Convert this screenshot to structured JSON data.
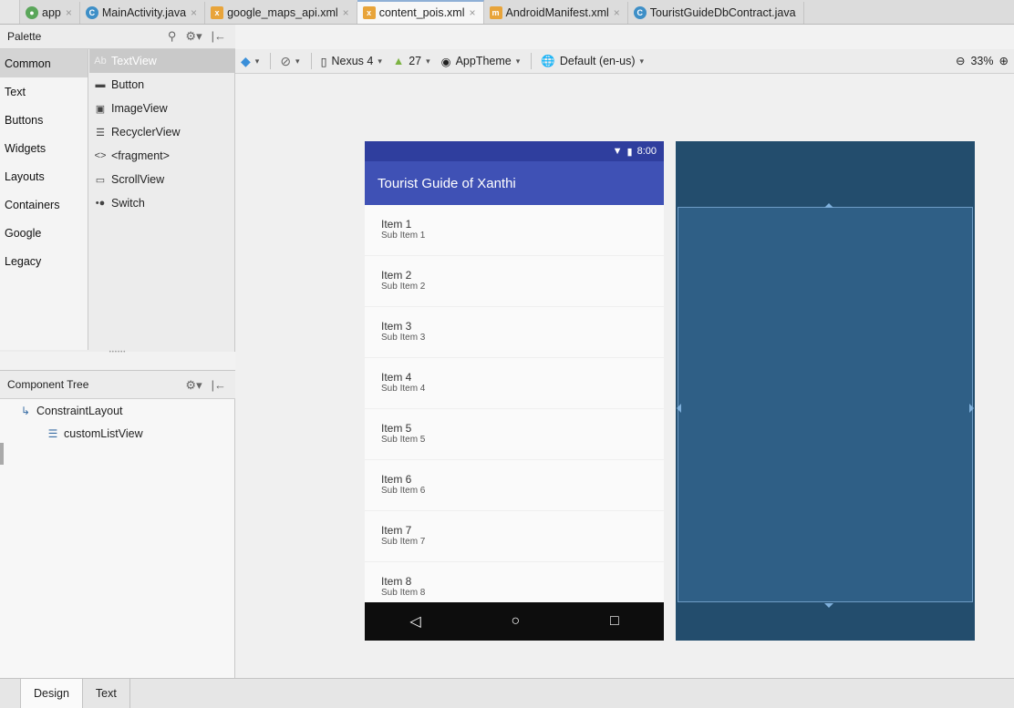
{
  "editor_tabs": [
    {
      "label": "app",
      "icon": "module-icon"
    },
    {
      "label": "MainActivity.java",
      "icon": "java-class-icon"
    },
    {
      "label": "google_maps_api.xml",
      "icon": "xml-file-icon"
    },
    {
      "label": "content_pois.xml",
      "icon": "layout-file-icon",
      "active": true
    },
    {
      "label": "AndroidManifest.xml",
      "icon": "manifest-icon"
    },
    {
      "label": "TouristGuideDbContract.java",
      "icon": "java-class-icon"
    }
  ],
  "palette": {
    "title": "Palette",
    "categories": [
      "Common",
      "Text",
      "Buttons",
      "Widgets",
      "Layouts",
      "Containers",
      "Google",
      "Legacy"
    ],
    "selected_category": "Common",
    "components": [
      {
        "label": "TextView",
        "icon": "Ab"
      },
      {
        "label": "Button",
        "icon": "▬"
      },
      {
        "label": "ImageView",
        "icon": "▣"
      },
      {
        "label": "RecyclerView",
        "icon": "☰"
      },
      {
        "label": "<fragment>",
        "icon": "<>"
      },
      {
        "label": "ScrollView",
        "icon": "▭"
      },
      {
        "label": "Switch",
        "icon": "•●"
      }
    ]
  },
  "component_tree": {
    "title": "Component Tree",
    "nodes": [
      {
        "label": "ConstraintLayout",
        "icon": "constraint-layout-icon"
      },
      {
        "label": "customListView",
        "icon": "list-view-icon"
      }
    ]
  },
  "toolbar": {
    "device": "Nexus 4",
    "api": "27",
    "theme": "AppTheme",
    "locale": "Default (en-us)",
    "zoom": "33%"
  },
  "device_preview": {
    "time": "8:00",
    "app_title": "Tourist Guide of Xanthi",
    "items": [
      {
        "title": "Item 1",
        "subtitle": "Sub Item 1"
      },
      {
        "title": "Item 2",
        "subtitle": "Sub Item 2"
      },
      {
        "title": "Item 3",
        "subtitle": "Sub Item 3"
      },
      {
        "title": "Item 4",
        "subtitle": "Sub Item 4"
      },
      {
        "title": "Item 5",
        "subtitle": "Sub Item 5"
      },
      {
        "title": "Item 6",
        "subtitle": "Sub Item 6"
      },
      {
        "title": "Item 7",
        "subtitle": "Sub Item 7"
      },
      {
        "title": "Item 8",
        "subtitle": "Sub Item 8"
      }
    ]
  },
  "bottom_tabs": [
    "Design",
    "Text"
  ],
  "colors": {
    "status_bar": "#2f3e9e",
    "app_bar": "#3f51b5",
    "blueprint_bg": "#234d6d",
    "blueprint_inner": "#2f5f86"
  }
}
